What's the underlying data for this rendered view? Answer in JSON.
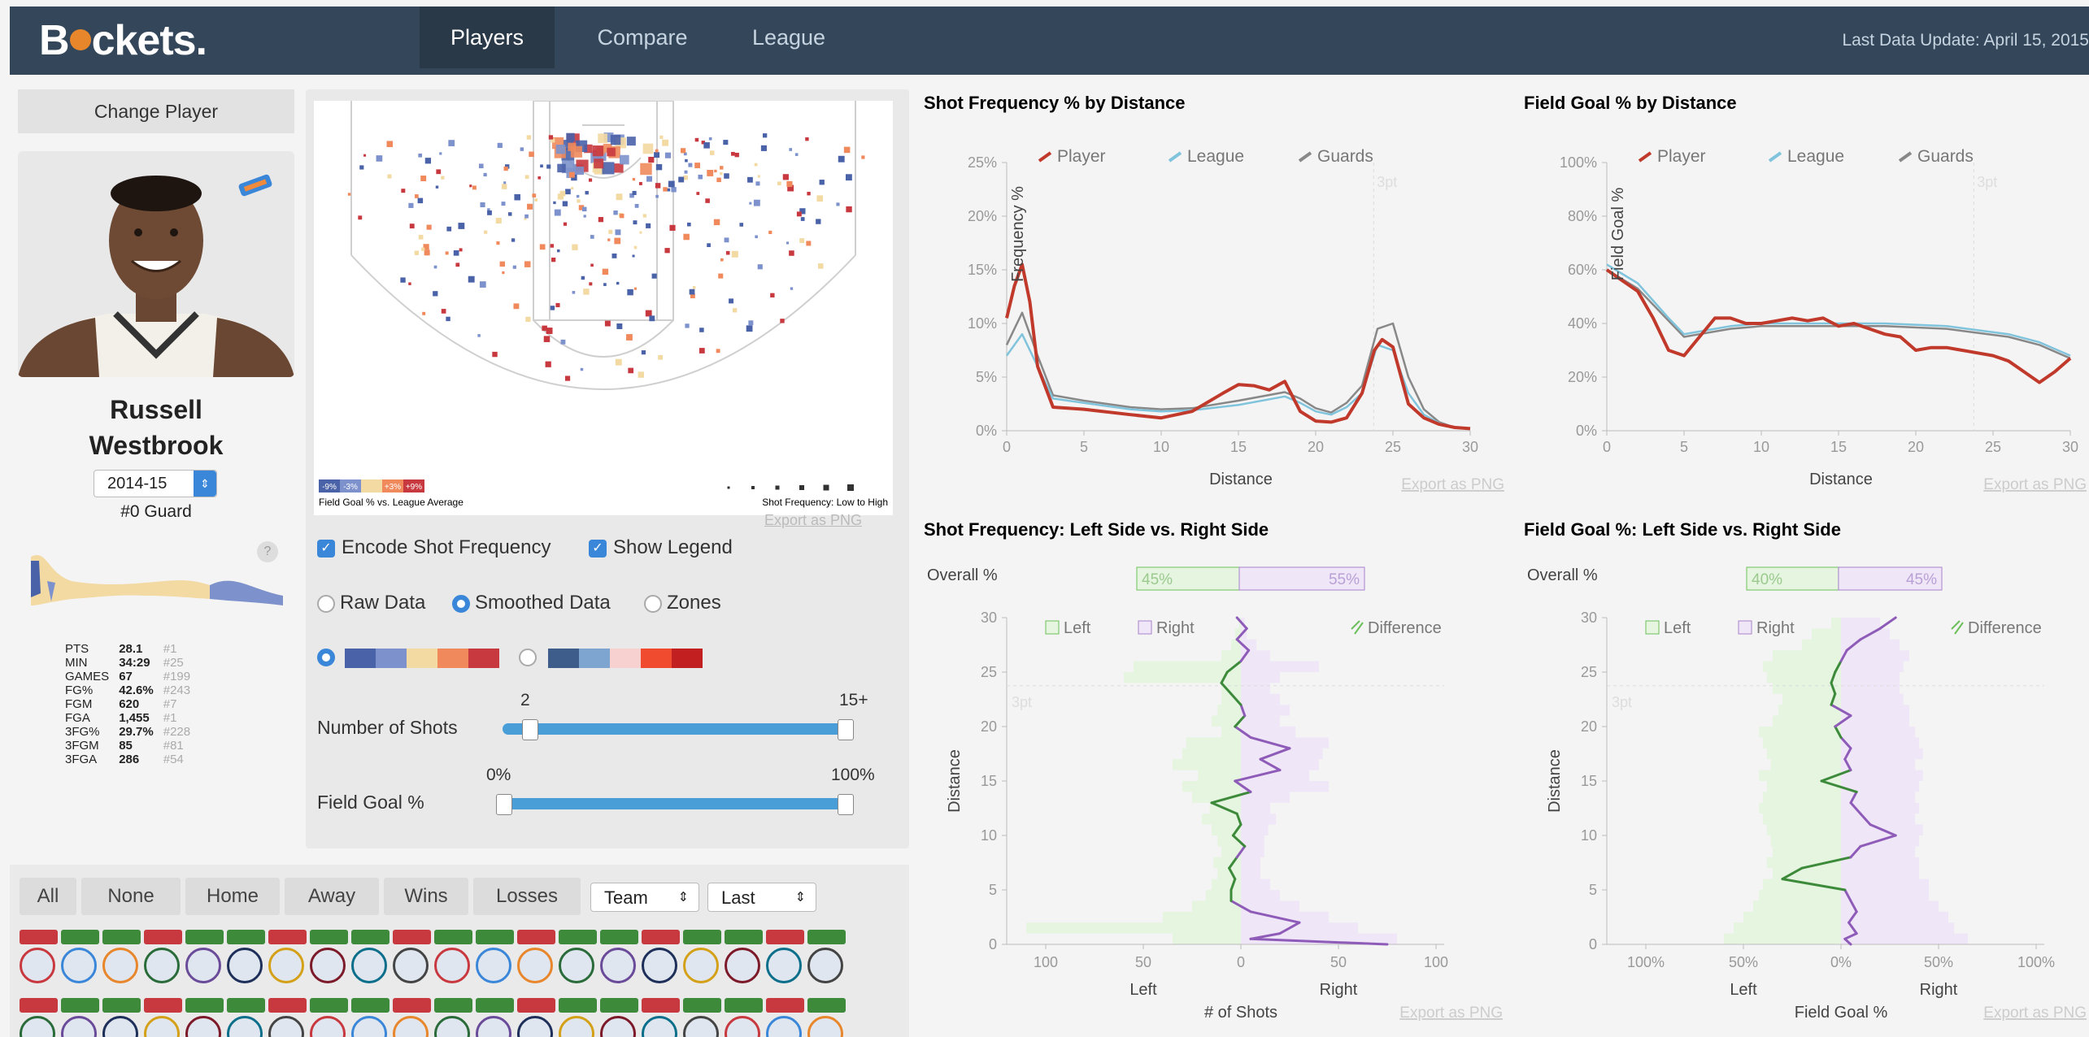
{
  "header": {
    "logo": "Buckets.",
    "tabs": [
      {
        "label": "Players"
      },
      {
        "label": "Compare"
      },
      {
        "label": "League"
      }
    ],
    "last_update": "Last Data Update: April 15, 2015"
  },
  "sidebar": {
    "change_player": "Change Player",
    "player_name_line1": "Russell",
    "player_name_line2": "Westbrook",
    "season": "2014-15",
    "position": "#0 Guard",
    "help": "?",
    "stats": [
      {
        "label": "PTS",
        "value": "28.1",
        "rank": "#1"
      },
      {
        "label": "MIN",
        "value": "34:29",
        "rank": "#25"
      },
      {
        "label": "GAMES",
        "value": "67",
        "rank": "#199"
      },
      {
        "label": "FG%",
        "value": "42.6%",
        "rank": "#243"
      },
      {
        "label": "FGM",
        "value": "620",
        "rank": "#7"
      },
      {
        "label": "FGA",
        "value": "1,455",
        "rank": "#1"
      },
      {
        "label": "3FG%",
        "value": "29.7%",
        "rank": "#228"
      },
      {
        "label": "3FGM",
        "value": "85",
        "rank": "#81"
      },
      {
        "label": "3FGA",
        "value": "286",
        "rank": "#54"
      }
    ]
  },
  "court": {
    "legend_left_caption": "Field Goal % vs. League Average",
    "legend_right_caption": "Shot Frequency: Low to High",
    "legend_chips": [
      "-9%",
      "-3%",
      "",
      "+3%",
      "+9%"
    ],
    "export": "Export as PNG",
    "encode_freq": "Encode Shot Frequency",
    "show_legend": "Show Legend",
    "raw": "Raw Data",
    "smoothed": "Smoothed Data",
    "zones": "Zones",
    "shots_label": "Number of Shots",
    "shots_min": "2",
    "shots_max": "15+",
    "fg_label": "Field Goal %",
    "fg_min": "0%",
    "fg_max": "100%",
    "colors": {
      "scheme1": [
        "#4a62a8",
        "#7d92cc",
        "#f3d9a2",
        "#f08a5d",
        "#c8383f"
      ],
      "scheme2": [
        "#3f5d8a",
        "#7ea5cf",
        "#f6d1cf",
        "#f04a2f",
        "#c22020"
      ]
    }
  },
  "filters": {
    "buttons": [
      "All",
      "None",
      "Home",
      "Away",
      "Wins",
      "Losses"
    ],
    "team": "Team",
    "last": "Last"
  },
  "charts": {
    "freq_dist": {
      "title": "Shot Frequency % by Distance",
      "legend": [
        "Player",
        "League",
        "Guards"
      ],
      "ylabel": "Frequency %",
      "xlabel": "Distance",
      "yticks": [
        "0%",
        "5%",
        "10%",
        "15%",
        "20%",
        "25%"
      ],
      "xticks": [
        "0",
        "5",
        "10",
        "15",
        "20",
        "25",
        "30"
      ],
      "three": "3pt",
      "export": "Export as PNG"
    },
    "fg_dist": {
      "title": "Field Goal % by Distance",
      "legend": [
        "Player",
        "League",
        "Guards"
      ],
      "ylabel": "Field Goal %",
      "xlabel": "Distance",
      "yticks": [
        "0%",
        "20%",
        "40%",
        "60%",
        "80%",
        "100%"
      ],
      "xticks": [
        "0",
        "5",
        "10",
        "15",
        "20",
        "25",
        "30"
      ],
      "three": "3pt",
      "export": "Export as PNG"
    },
    "freq_side": {
      "title": "Shot Frequency: Left Side vs. Right Side",
      "overall_label": "Overall %",
      "overall_left": "45%",
      "overall_right": "55%",
      "legend_left": "Left",
      "legend_right": "Right",
      "legend_diff": "Difference",
      "ylabel": "Distance",
      "yticks": [
        "0",
        "5",
        "10",
        "15",
        "20",
        "25",
        "30"
      ],
      "xticks": [
        "100",
        "50",
        "0",
        "50",
        "100"
      ],
      "left_label": "Left",
      "right_label": "Right",
      "xlabel": "# of Shots",
      "three": "3pt",
      "export": "Export as PNG"
    },
    "fg_side": {
      "title": "Field Goal %: Left Side vs. Right Side",
      "overall_label": "Overall %",
      "overall_left": "40%",
      "overall_right": "45%",
      "legend_left": "Left",
      "legend_right": "Right",
      "legend_diff": "Difference",
      "ylabel": "Distance",
      "yticks": [
        "0",
        "5",
        "10",
        "15",
        "20",
        "25",
        "30"
      ],
      "xticks": [
        "100%",
        "50%",
        "0%",
        "50%",
        "100%"
      ],
      "left_label": "Left",
      "right_label": "Right",
      "xlabel": "Field Goal %",
      "three": "3pt",
      "export": "Export as PNG"
    }
  },
  "chart_data": [
    {
      "type": "line",
      "title": "Shot Frequency % by Distance",
      "xlabel": "Distance",
      "ylabel": "Frequency %",
      "xlim": [
        0,
        30
      ],
      "ylim": [
        0,
        25
      ],
      "series": [
        {
          "name": "Player",
          "color": "#c0392b",
          "x": [
            0,
            0.5,
            1,
            1.5,
            2,
            3,
            5,
            8,
            10,
            12,
            14,
            15,
            16,
            17,
            18,
            19,
            20,
            21,
            22,
            23,
            23.8,
            24.3,
            25,
            26,
            27,
            28,
            29,
            30
          ],
          "y": [
            10.5,
            13.5,
            15.5,
            12,
            6,
            2.2,
            2,
            1.5,
            1.2,
            1.8,
            3.5,
            4.3,
            4.2,
            3.8,
            4.6,
            1.8,
            0.9,
            0.8,
            1.2,
            3.5,
            7.5,
            8.5,
            7.8,
            2.5,
            1.2,
            0.6,
            0.3,
            0.2
          ]
        },
        {
          "name": "League",
          "color": "#7fc4dc",
          "x": [
            0,
            0.5,
            1,
            2,
            3,
            5,
            8,
            10,
            12,
            15,
            18,
            19,
            20,
            21,
            22,
            23,
            24,
            25,
            26,
            27,
            28,
            29,
            30
          ],
          "y": [
            7,
            8,
            9,
            6,
            3,
            2.6,
            2,
            1.8,
            1.9,
            2.4,
            3.2,
            2.6,
            1.8,
            1.5,
            2.2,
            3.5,
            8,
            7.5,
            3.5,
            1.5,
            0.7,
            0.3,
            0.2
          ]
        },
        {
          "name": "Guards",
          "color": "#888888",
          "x": [
            0,
            0.5,
            1,
            2,
            3,
            5,
            8,
            10,
            12,
            15,
            18,
            19,
            20,
            21,
            22,
            23,
            24,
            25,
            26,
            27,
            28,
            29,
            30
          ],
          "y": [
            8,
            9.5,
            11,
            7,
            3.3,
            2.8,
            2.2,
            2,
            2.1,
            2.8,
            3.6,
            3,
            2.1,
            1.7,
            2.6,
            4.2,
            9.5,
            10,
            5,
            2,
            0.8,
            0.3,
            0.2
          ]
        }
      ]
    },
    {
      "type": "line",
      "title": "Field Goal % by Distance",
      "xlabel": "Distance",
      "ylabel": "Field Goal %",
      "xlim": [
        0,
        30
      ],
      "ylim": [
        0,
        100
      ],
      "series": [
        {
          "name": "Player",
          "color": "#c0392b",
          "x": [
            0,
            1,
            2,
            3,
            4,
            5,
            6,
            7,
            8,
            9,
            10,
            11,
            12,
            13,
            14,
            15,
            16,
            17,
            18,
            19,
            20,
            21,
            22,
            23,
            24,
            25,
            26,
            27,
            28,
            29,
            30
          ],
          "y": [
            60,
            56,
            52,
            42,
            30,
            28,
            35,
            42,
            42,
            40,
            40,
            41,
            42,
            41,
            42,
            39,
            40,
            38,
            36,
            35,
            30,
            31,
            31,
            30,
            29,
            28,
            26,
            22,
            18,
            22,
            27
          ]
        },
        {
          "name": "League",
          "color": "#7fc4dc",
          "x": [
            0,
            2,
            4,
            5,
            6,
            8,
            10,
            14,
            18,
            22,
            26,
            28,
            30
          ],
          "y": [
            62,
            55,
            42,
            36,
            37,
            39,
            40,
            40,
            40,
            39,
            36,
            33,
            28
          ]
        },
        {
          "name": "Guards",
          "color": "#888888",
          "x": [
            0,
            2,
            4,
            5,
            6,
            8,
            10,
            14,
            18,
            22,
            26,
            28,
            30
          ],
          "y": [
            60,
            53,
            41,
            35,
            36,
            38,
            39,
            39,
            39,
            38,
            35,
            32,
            27
          ]
        }
      ]
    },
    {
      "type": "area",
      "title": "Shot Frequency: Left Side vs. Right Side",
      "xlabel": "# of Shots",
      "ylabel": "Distance",
      "ylim": [
        0,
        30
      ],
      "xlim": [
        -100,
        100
      ],
      "overall": {
        "Left": 45,
        "Right": 55
      },
      "series": [
        {
          "name": "Left",
          "y": [
            0,
            1,
            2,
            3,
            4,
            5,
            6,
            7,
            8,
            9,
            10,
            11,
            12,
            13,
            14,
            15,
            16,
            17,
            18,
            19,
            20,
            21,
            22,
            23,
            24,
            25,
            26,
            27,
            28,
            29
          ],
          "values": [
            35,
            110,
            40,
            25,
            18,
            15,
            12,
            14,
            10,
            12,
            15,
            20,
            16,
            25,
            30,
            22,
            35,
            30,
            28,
            10,
            15,
            12,
            10,
            10,
            60,
            55,
            10,
            5,
            3,
            1
          ]
        },
        {
          "name": "Right",
          "y": [
            0,
            1,
            2,
            3,
            4,
            5,
            6,
            7,
            8,
            9,
            10,
            11,
            12,
            13,
            14,
            15,
            16,
            17,
            18,
            19,
            20,
            21,
            22,
            23,
            24,
            25,
            26,
            27,
            28,
            29
          ],
          "values": [
            80,
            60,
            45,
            30,
            20,
            15,
            10,
            10,
            12,
            12,
            14,
            18,
            15,
            25,
            45,
            35,
            40,
            42,
            45,
            28,
            20,
            25,
            20,
            15,
            20,
            40,
            15,
            8,
            3,
            2
          ]
        },
        {
          "name": "Difference",
          "y": [
            0,
            0.5,
            1,
            2,
            3,
            4,
            5,
            6,
            7,
            8,
            9,
            10,
            11,
            12,
            13,
            14,
            15,
            16,
            17,
            18,
            19,
            20,
            21,
            22,
            23,
            24,
            25,
            26,
            27,
            28,
            29,
            30
          ],
          "values": [
            75,
            5,
            20,
            30,
            5,
            -5,
            -5,
            -3,
            -6,
            -2,
            2,
            -4,
            0,
            -2,
            -15,
            5,
            -3,
            20,
            10,
            25,
            5,
            -3,
            2,
            0,
            -5,
            -10,
            -7,
            0,
            4,
            -2,
            3,
            -2
          ]
        }
      ]
    },
    {
      "type": "area",
      "title": "Field Goal %: Left Side vs. Right Side",
      "xlabel": "Field Goal %",
      "ylabel": "Distance",
      "ylim": [
        0,
        30
      ],
      "xlim": [
        -100,
        100
      ],
      "overall": {
        "Left": 40,
        "Right": 45
      },
      "series": [
        {
          "name": "Left",
          "y": [
            0,
            1,
            2,
            3,
            4,
            5,
            6,
            7,
            8,
            9,
            10,
            11,
            12,
            13,
            14,
            15,
            16,
            17,
            18,
            19,
            20,
            21,
            22,
            23,
            24,
            25,
            26,
            27,
            28,
            29
          ],
          "values": [
            60,
            55,
            50,
            45,
            42,
            40,
            35,
            38,
            35,
            36,
            38,
            40,
            42,
            40,
            38,
            42,
            36,
            38,
            40,
            42,
            35,
            32,
            30,
            35,
            38,
            40,
            35,
            20,
            15,
            5
          ]
        },
        {
          "name": "Right",
          "y": [
            0,
            1,
            2,
            3,
            4,
            5,
            6,
            7,
            8,
            9,
            10,
            11,
            12,
            13,
            14,
            15,
            16,
            17,
            18,
            19,
            20,
            21,
            22,
            23,
            24,
            25,
            26,
            27,
            28,
            29
          ],
          "values": [
            65,
            58,
            55,
            50,
            45,
            45,
            40,
            40,
            38,
            40,
            42,
            38,
            40,
            38,
            40,
            42,
            38,
            42,
            40,
            38,
            35,
            35,
            32,
            30,
            30,
            32,
            35,
            30,
            25,
            20
          ]
        },
        {
          "name": "Difference",
          "y": [
            0,
            0.5,
            1,
            2,
            3,
            4,
            5,
            6,
            7,
            8,
            9,
            10,
            11,
            12,
            13,
            14,
            15,
            16,
            17,
            18,
            19,
            20,
            21,
            22,
            23,
            24,
            25,
            26,
            27,
            28,
            29,
            30
          ],
          "values": [
            5,
            2,
            8,
            4,
            8,
            5,
            2,
            -30,
            -20,
            5,
            10,
            28,
            15,
            10,
            5,
            8,
            -10,
            5,
            2,
            5,
            0,
            -3,
            5,
            -5,
            -3,
            -5,
            -3,
            0,
            3,
            10,
            20,
            28
          ]
        }
      ]
    }
  ]
}
